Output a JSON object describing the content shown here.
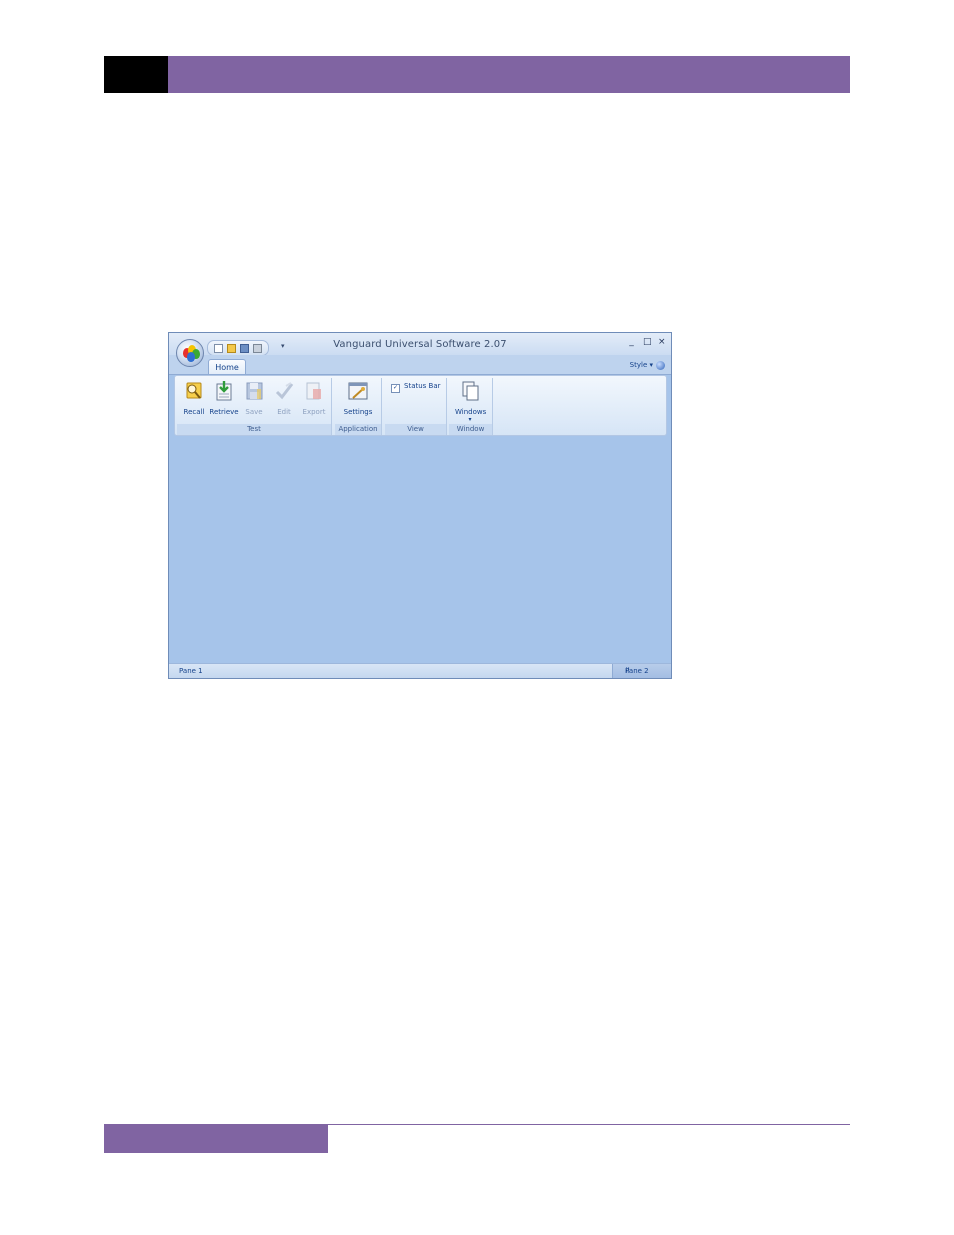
{
  "window": {
    "title": "Vanguard Universal Software 2.07",
    "controls": {
      "minimize": "_",
      "maximize": "□",
      "close": "×"
    },
    "qat_more": "▾"
  },
  "ribbon": {
    "tabs": [
      {
        "label": "Home"
      }
    ],
    "style_menu": "Style  ▾",
    "groups": {
      "test": {
        "label": "Test",
        "buttons": [
          {
            "label": "Recall"
          },
          {
            "label": "Retrieve"
          },
          {
            "label": "Save"
          },
          {
            "label": "Edit"
          },
          {
            "label": "Export"
          }
        ]
      },
      "application": {
        "label": "Application",
        "buttons": [
          {
            "label": "Settings"
          }
        ]
      },
      "view": {
        "label": "View",
        "checkbox": {
          "label": "Status Bar",
          "checked": true,
          "mark": "✓"
        }
      },
      "window": {
        "label": "Window",
        "buttons": [
          {
            "label": "Windows",
            "dropdown": "▾"
          }
        ]
      }
    }
  },
  "statusbar": {
    "pane1": "Pane 1",
    "pane2": "Pane 2"
  },
  "colors": {
    "accent": "#8064a2",
    "client_bg": "#a6c4ea",
    "header_black": "#000000"
  }
}
